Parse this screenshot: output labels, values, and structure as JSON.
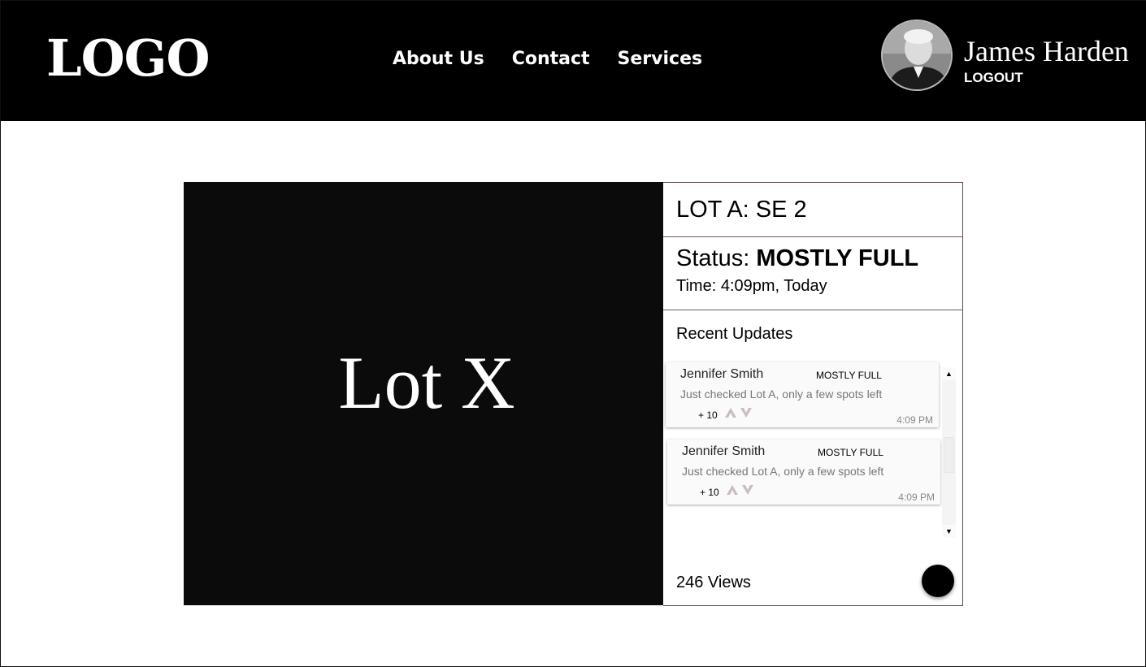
{
  "header": {
    "logo": "LOGO",
    "nav": [
      {
        "label": "About Us"
      },
      {
        "label": "Contact"
      },
      {
        "label": "Services"
      }
    ],
    "user": {
      "name": "James Harden",
      "logout_label": "LOGOUT"
    }
  },
  "lot_image": {
    "label": "Lot X"
  },
  "panel": {
    "title": "LOT A: SE 2",
    "status_prefix": "Status:",
    "status_value": "MOSTLY FULL",
    "time": "Time: 4:09pm, Today",
    "recent_title": "Recent Updates",
    "updates": [
      {
        "author": "Jennifer Smith",
        "status": "MOSTLY FULL",
        "message": "Just checked Lot A, only a few spots left",
        "score": "+ 10",
        "time": "4:09 PM"
      },
      {
        "author": "Jennifer Smith",
        "status": "MOSTLY FULL",
        "message": "Just checked Lot A, only a few spots left",
        "score": "+ 10",
        "time": "4:09 PM"
      }
    ],
    "views": "246 Views"
  },
  "icons": {
    "scroll_up": "▲",
    "scroll_down": "▼",
    "upvote": "chevron-up-icon",
    "downvote": "chevron-down-icon",
    "vote_color": "#c9bdbd"
  }
}
